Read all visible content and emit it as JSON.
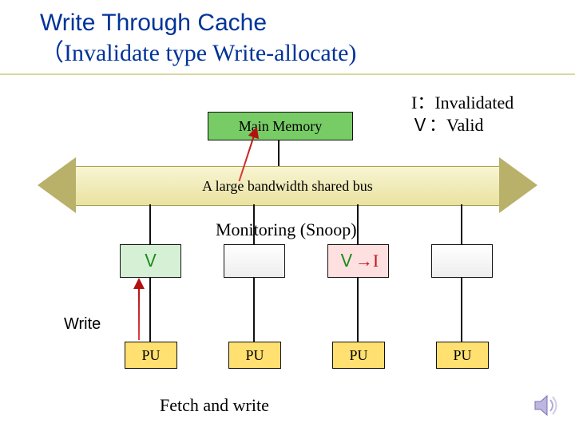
{
  "title_line1": "Write Through Cache",
  "title_line2": "（Invalidate type Write-allocate)",
  "legend_line1": "I：Invalidated",
  "legend_line2": "Ｖ：Valid",
  "main_memory": "Main Memory",
  "bus_label": "A large bandwidth shared bus",
  "snoop_label": "Monitoring (Snoop)",
  "caches": {
    "c1": "Ｖ",
    "c2": "",
    "c3_v": "Ｖ",
    "c3_arrow": "→",
    "c3_i": "I",
    "c4": ""
  },
  "write_label": "Write",
  "pu_label": "PU",
  "fetch_label": "Fetch and write",
  "colors": {
    "title": "#003399",
    "mem_bg": "#77cc66",
    "bus_bg": "#e9e2a0",
    "pu_bg": "#ffe070",
    "valid": "#1a8a1a",
    "invalid": "#c01717"
  }
}
